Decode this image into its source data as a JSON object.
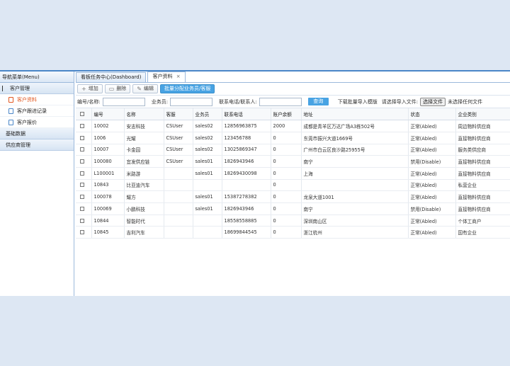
{
  "sidebar": {
    "header": "导航菜单(Menu)",
    "group1": "客户管理",
    "items": [
      "客户资料",
      "客户跟进记录",
      "客户报价"
    ],
    "group2": "基础数据",
    "group3": "供应商管理"
  },
  "tabs": [
    {
      "label": "看板任务中心(Dashboard)"
    },
    {
      "label": "客户资料",
      "close": "×"
    }
  ],
  "toolbar": {
    "add": "增加",
    "delete": "删除",
    "edit": "编辑",
    "assign": "批量分配业务员/客服"
  },
  "filter": {
    "code_label": "编号/名称:",
    "sales_label": "业务员:",
    "contact_label": "联系电话/联系人:",
    "query": "查询",
    "import_template": "下载批量导入模版",
    "choose_file_label": "请选择导入文件:",
    "choose_file_btn": "选择文件",
    "no_file": "未选择任何文件"
  },
  "table": {
    "headers": [
      "编号",
      "名称",
      "客服",
      "业务员",
      "联系电话",
      "账户余额",
      "地址",
      "状态",
      "企业类别"
    ],
    "rows": [
      [
        "10002",
        "安志科技",
        "CSUser",
        "sales02",
        "12856963875",
        "2000",
        "成都是青羊区万达广场A3栋502号",
        "正常(Abled)",
        "周边物料供应商"
      ],
      [
        "1006",
        "光耀",
        "CSUser",
        "sales02",
        "123456788",
        "0",
        "东莞市振兴大道1669号",
        "正常(Abled)",
        "直接物料供应商"
      ],
      [
        "10007",
        "卡金园",
        "CSUser",
        "sales02",
        "13025869347",
        "0",
        "广州市白云区良沙路25955号",
        "正常(Abled)",
        "服务类供应商"
      ],
      [
        "100080",
        "宜发供应链",
        "CSUser",
        "sales01",
        "1826943946",
        "0",
        "南宁",
        "禁用(Disable)",
        "直接物料供应商"
      ],
      [
        "L100001",
        "米路游",
        "",
        "sales01",
        "18269430098",
        "0",
        "上海",
        "正常(Abled)",
        "直接物料供应商"
      ],
      [
        "10843",
        "比亚迪汽车",
        "",
        "",
        "",
        "0",
        "",
        "正常(Abled)",
        "私营企业"
      ],
      [
        "100078",
        "耀方",
        "",
        "sales01",
        "15387278382",
        "0",
        "龙泉大道1001",
        "正常(Abled)",
        "直接物料供应商"
      ],
      [
        "100069",
        "小鹏科技",
        "",
        "sales01",
        "1826943946",
        "0",
        "南宁",
        "禁用(Disable)",
        "直接物料供应商"
      ],
      [
        "10844",
        "智能时代",
        "",
        "",
        "18558558885",
        "0",
        "深圳南山区",
        "正常(Abled)",
        "个体工商户"
      ],
      [
        "10845",
        "吉利汽车",
        "",
        "",
        "18699844545",
        "0",
        "浙江杭州",
        "正常(Abled)",
        "国有企业"
      ]
    ]
  }
}
